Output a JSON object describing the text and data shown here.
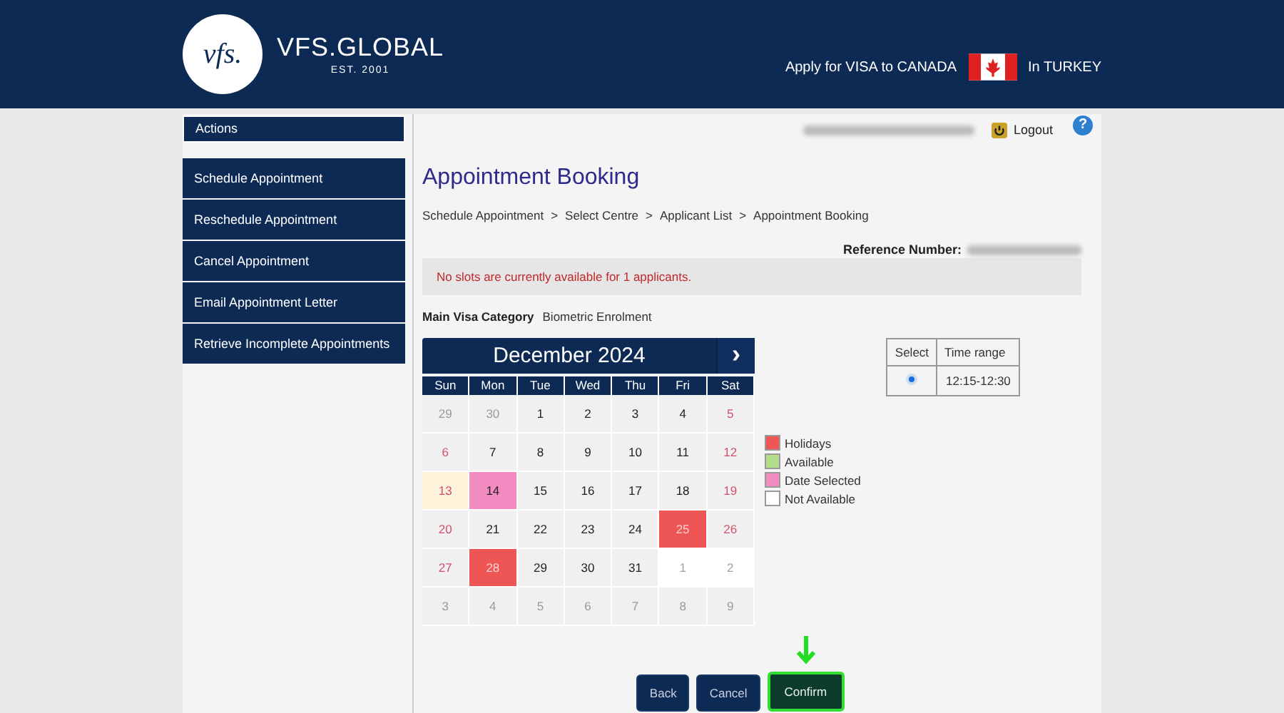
{
  "header": {
    "brand": "VFS.GLOBAL",
    "logo_mark": "vfs.",
    "since": "EST. 2001",
    "apply_text": "Apply for VISA to CANADA",
    "country_text": "In TURKEY"
  },
  "sidebar": {
    "title": "Actions",
    "items": [
      {
        "label": "Schedule Appointment"
      },
      {
        "label": "Reschedule Appointment"
      },
      {
        "label": "Cancel Appointment"
      },
      {
        "label": "Email Appointment Letter"
      },
      {
        "label": "Retrieve Incomplete Appointments"
      }
    ]
  },
  "topbar": {
    "logout": "Logout",
    "help": "?"
  },
  "page_title": "Appointment Booking",
  "breadcrumb": [
    "Schedule Appointment",
    "Select Centre",
    "Applicant List",
    "Appointment Booking"
  ],
  "breadcrumb_separator": ">",
  "reference_label": "Reference Number:",
  "message": "No slots are currently available for 1 applicants.",
  "category": {
    "label": "Main Visa Category",
    "value": "Biometric Enrolment"
  },
  "calendar": {
    "month": "December 2024",
    "next": "›",
    "weekdays": [
      "Sun",
      "Mon",
      "Tue",
      "Wed",
      "Thu",
      "Fri",
      "Sat"
    ],
    "weeks": [
      [
        {
          "day": "29",
          "kind": "muted"
        },
        {
          "day": "30",
          "kind": "muted"
        },
        {
          "day": "1",
          "kind": "day"
        },
        {
          "day": "2",
          "kind": "day"
        },
        {
          "day": "3",
          "kind": "day"
        },
        {
          "day": "4",
          "kind": "day"
        },
        {
          "day": "5",
          "kind": "weekend"
        }
      ],
      [
        {
          "day": "6",
          "kind": "weekend"
        },
        {
          "day": "7",
          "kind": "day"
        },
        {
          "day": "8",
          "kind": "day"
        },
        {
          "day": "9",
          "kind": "day"
        },
        {
          "day": "10",
          "kind": "day"
        },
        {
          "day": "11",
          "kind": "day"
        },
        {
          "day": "12",
          "kind": "weekend"
        }
      ],
      [
        {
          "day": "13",
          "kind": "today"
        },
        {
          "day": "14",
          "kind": "selected"
        },
        {
          "day": "15",
          "kind": "day"
        },
        {
          "day": "16",
          "kind": "day"
        },
        {
          "day": "17",
          "kind": "day"
        },
        {
          "day": "18",
          "kind": "day"
        },
        {
          "day": "19",
          "kind": "weekend"
        }
      ],
      [
        {
          "day": "20",
          "kind": "weekend"
        },
        {
          "day": "21",
          "kind": "day"
        },
        {
          "day": "22",
          "kind": "day"
        },
        {
          "day": "23",
          "kind": "day"
        },
        {
          "day": "24",
          "kind": "day"
        },
        {
          "day": "25",
          "kind": "holiday"
        },
        {
          "day": "26",
          "kind": "weekend"
        }
      ],
      [
        {
          "day": "27",
          "kind": "weekend"
        },
        {
          "day": "28",
          "kind": "holiday"
        },
        {
          "day": "29",
          "kind": "day"
        },
        {
          "day": "30",
          "kind": "day"
        },
        {
          "day": "31",
          "kind": "day"
        },
        {
          "day": "1",
          "kind": "unavailable"
        },
        {
          "day": "2",
          "kind": "unavailable"
        }
      ],
      [
        {
          "day": "3",
          "kind": "muted"
        },
        {
          "day": "4",
          "kind": "muted"
        },
        {
          "day": "5",
          "kind": "muted"
        },
        {
          "day": "6",
          "kind": "muted"
        },
        {
          "day": "7",
          "kind": "muted"
        },
        {
          "day": "8",
          "kind": "muted"
        },
        {
          "day": "9",
          "kind": "muted"
        }
      ]
    ]
  },
  "legend": [
    {
      "label": "Holidays",
      "color": "#ee5555"
    },
    {
      "label": "Available",
      "color": "#b5dc8a"
    },
    {
      "label": "Date Selected",
      "color": "#f18bc0"
    },
    {
      "label": "Not Available",
      "color": "#ffffff"
    }
  ],
  "slots": {
    "columns": [
      "Select",
      "Time range"
    ],
    "rows": [
      {
        "time": "12:15-12:30",
        "selected": true
      }
    ]
  },
  "buttons": [
    {
      "label": "Back",
      "highlighted": false
    },
    {
      "label": "Cancel",
      "highlighted": false
    },
    {
      "label": "Confirm",
      "highlighted": true
    }
  ]
}
